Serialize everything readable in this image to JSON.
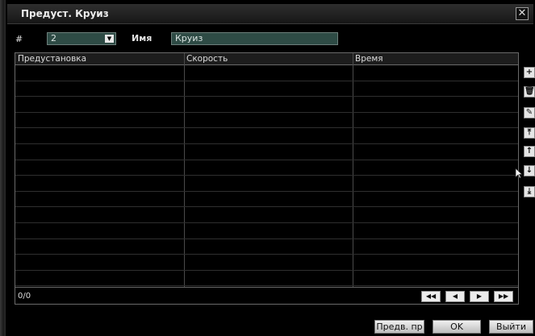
{
  "window": {
    "title": "Предуст. Круиз",
    "close_label": "✕"
  },
  "form": {
    "number_label": "#",
    "number_value": "2",
    "name_label": "Имя",
    "name_value": "Круиз"
  },
  "table": {
    "columns": [
      "Предустановка",
      "Скорость",
      "Время"
    ],
    "rows": [],
    "counter": "0/0"
  },
  "pager": {
    "first": "◀◀",
    "prev": "◀",
    "next": "▶",
    "last": "▶▶"
  },
  "side_icons": [
    "plus-icon",
    "trash-icon",
    "edit-icon",
    "move-top-icon",
    "move-up-icon",
    "move-down-icon",
    "move-bottom-icon"
  ],
  "buttons": {
    "preview": "Предв. пр",
    "ok": "OK",
    "exit": "Выйти"
  }
}
